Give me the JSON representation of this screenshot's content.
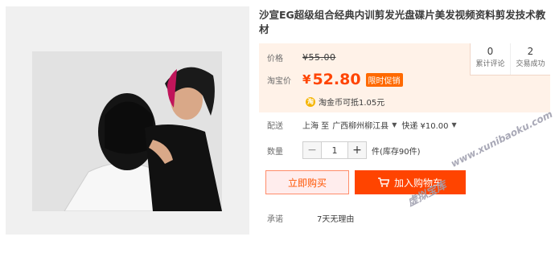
{
  "product": {
    "title": "沙宣EG超级组合经典内训剪发光盘碟片美发视频资料剪发技术教材"
  },
  "price": {
    "orig_label": "价格",
    "orig_value": "¥55.00",
    "now_label": "淘宝价",
    "currency": "¥",
    "now_value": "52.80",
    "promo_badge": "限时促销"
  },
  "stats": [
    {
      "num": "0",
      "cap": "累计评论"
    },
    {
      "num": "2",
      "cap": "交易成功"
    }
  ],
  "coin": {
    "icon": "淘",
    "text": "淘金币可抵1.05元"
  },
  "shipping": {
    "label": "配送",
    "from": "上海 至",
    "to": "广西柳州柳江县",
    "method": "快递 ¥10.00"
  },
  "quantity": {
    "label": "数量",
    "minus": "−",
    "value": "1",
    "plus": "+",
    "stock": "件(库存90件)"
  },
  "actions": {
    "buy_now": "立即购买",
    "add_cart": "加入购物车"
  },
  "promise": {
    "label": "承诺",
    "text": "7天无理由"
  },
  "watermark": {
    "cn": "虚拟宝库",
    "url": "www.xunibaoku.com"
  },
  "colors": {
    "accent": "#ff4400",
    "price_box_bg": "#fff2e8"
  }
}
